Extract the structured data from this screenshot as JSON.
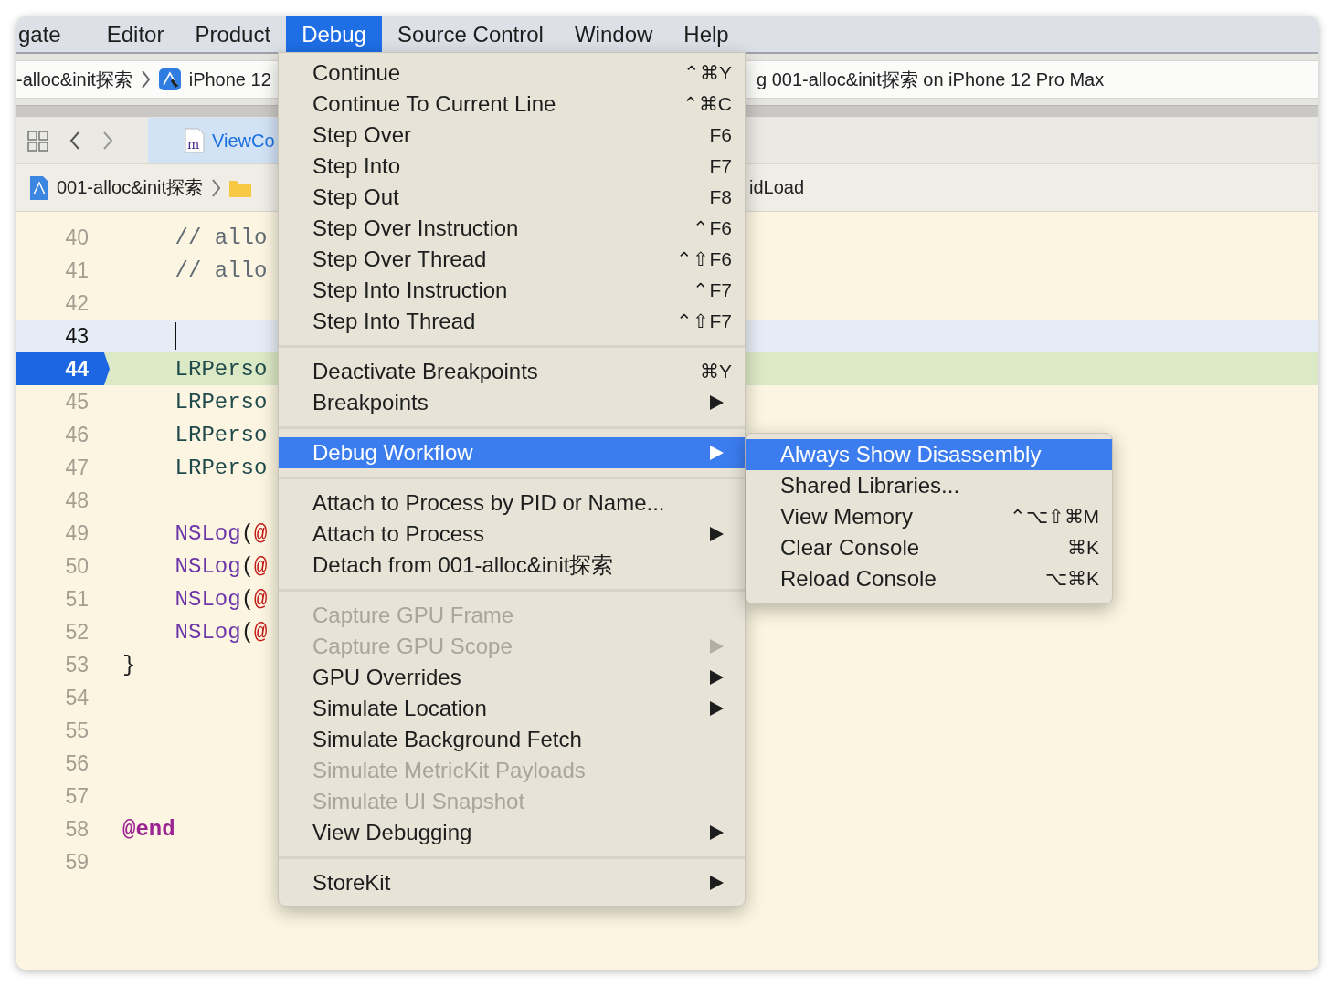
{
  "menubar": [
    {
      "label": "gate",
      "selected": false
    },
    {
      "label": "Editor",
      "selected": false
    },
    {
      "label": "Product",
      "selected": false
    },
    {
      "label": "Debug",
      "selected": true
    },
    {
      "label": "Source Control",
      "selected": false
    },
    {
      "label": "Window",
      "selected": false
    },
    {
      "label": "Help",
      "selected": false
    }
  ],
  "toolbar": {
    "scheme": "-alloc&init探索",
    "device": "iPhone 12",
    "activity": "g 001-alloc&init探索 on iPhone 12 Pro Max"
  },
  "tab": {
    "label": "ViewCo",
    "icon_text": "m",
    "selected": true
  },
  "jump_bar": {
    "project": "001-alloc&init探索",
    "method": "idLoad"
  },
  "editor": {
    "lines": [
      {
        "number": "40",
        "current": false,
        "execution_point": false,
        "tokens": [
          {
            "text": "    // allo",
            "kind": "comment"
          }
        ]
      },
      {
        "number": "41",
        "current": false,
        "execution_point": false,
        "tokens": [
          {
            "text": "    // allo",
            "kind": "comment"
          }
        ]
      },
      {
        "number": "42",
        "current": false,
        "execution_point": false
      },
      {
        "number": "43",
        "current": true,
        "execution_point": false
      },
      {
        "number": "44",
        "current": false,
        "execution_point": true,
        "tokens": [
          {
            "text": "    LRPerso",
            "kind": "type"
          }
        ]
      },
      {
        "number": "45",
        "current": false,
        "execution_point": false,
        "tokens": [
          {
            "text": "    LRPerso",
            "kind": "type"
          }
        ]
      },
      {
        "number": "46",
        "current": false,
        "execution_point": false,
        "tokens": [
          {
            "text": "    LRPerso",
            "kind": "type"
          }
        ]
      },
      {
        "number": "47",
        "current": false,
        "execution_point": false,
        "tokens": [
          {
            "text": "    LRPerso",
            "kind": "type"
          }
        ]
      },
      {
        "number": "48",
        "current": false,
        "execution_point": false
      },
      {
        "number": "49",
        "current": false,
        "execution_point": false,
        "tokens": [
          {
            "text": "    NSLog",
            "kind": "function"
          },
          {
            "text": "(",
            "kind": "plain"
          },
          {
            "text": "@",
            "kind": "string"
          }
        ]
      },
      {
        "number": "50",
        "current": false,
        "execution_point": false,
        "tokens": [
          {
            "text": "    NSLog",
            "kind": "function"
          },
          {
            "text": "(",
            "kind": "plain"
          },
          {
            "text": "@",
            "kind": "string"
          }
        ]
      },
      {
        "number": "51",
        "current": false,
        "execution_point": false,
        "tokens": [
          {
            "text": "    NSLog",
            "kind": "function"
          },
          {
            "text": "(",
            "kind": "plain"
          },
          {
            "text": "@",
            "kind": "string"
          }
        ]
      },
      {
        "number": "52",
        "current": false,
        "execution_point": false,
        "tokens": [
          {
            "text": "    NSLog",
            "kind": "function"
          },
          {
            "text": "(",
            "kind": "plain"
          },
          {
            "text": "@",
            "kind": "string"
          }
        ]
      },
      {
        "number": "53",
        "current": false,
        "execution_point": false,
        "tokens": [
          {
            "text": "}",
            "kind": "plain"
          }
        ]
      },
      {
        "number": "54",
        "current": false,
        "execution_point": false
      },
      {
        "number": "55",
        "current": false,
        "execution_point": false
      },
      {
        "number": "56",
        "current": false,
        "execution_point": false
      },
      {
        "number": "57",
        "current": false,
        "execution_point": false
      },
      {
        "number": "58",
        "current": false,
        "execution_point": false,
        "tokens": [
          {
            "text": "@end",
            "kind": "keyword"
          }
        ]
      },
      {
        "number": "59",
        "current": false,
        "execution_point": false
      }
    ]
  },
  "debug_menu": {
    "items": [
      {
        "kind": "item",
        "label": "Continue",
        "shortcut": "⌃⌘Y",
        "submenu": false,
        "disabled": false,
        "selected": false
      },
      {
        "kind": "item",
        "label": "Continue To Current Line",
        "shortcut": "⌃⌘C",
        "submenu": false,
        "disabled": false,
        "selected": false
      },
      {
        "kind": "item",
        "label": "Step Over",
        "shortcut": "F6",
        "submenu": false,
        "disabled": false,
        "selected": false
      },
      {
        "kind": "item",
        "label": "Step Into",
        "shortcut": "F7",
        "submenu": false,
        "disabled": false,
        "selected": false
      },
      {
        "kind": "item",
        "label": "Step Out",
        "shortcut": "F8",
        "submenu": false,
        "disabled": false,
        "selected": false
      },
      {
        "kind": "item",
        "label": "Step Over Instruction",
        "shortcut": "⌃F6",
        "submenu": false,
        "disabled": false,
        "selected": false
      },
      {
        "kind": "item",
        "label": "Step Over Thread",
        "shortcut": "⌃⇧F6",
        "submenu": false,
        "disabled": false,
        "selected": false
      },
      {
        "kind": "item",
        "label": "Step Into Instruction",
        "shortcut": "⌃F7",
        "submenu": false,
        "disabled": false,
        "selected": false
      },
      {
        "kind": "item",
        "label": "Step Into Thread",
        "shortcut": "⌃⇧F7",
        "submenu": false,
        "disabled": false,
        "selected": false
      },
      {
        "kind": "separator"
      },
      {
        "kind": "item",
        "label": "Deactivate Breakpoints",
        "shortcut": "⌘Y",
        "submenu": false,
        "disabled": false,
        "selected": false
      },
      {
        "kind": "item",
        "label": "Breakpoints",
        "submenu": true,
        "disabled": false,
        "selected": false
      },
      {
        "kind": "separator"
      },
      {
        "kind": "item",
        "label": "Debug Workflow",
        "submenu": true,
        "disabled": false,
        "selected": true
      },
      {
        "kind": "separator"
      },
      {
        "kind": "item",
        "label": "Attach to Process by PID or Name...",
        "submenu": false,
        "disabled": false,
        "selected": false
      },
      {
        "kind": "item",
        "label": "Attach to Process",
        "submenu": true,
        "disabled": false,
        "selected": false
      },
      {
        "kind": "item",
        "label": "Detach from 001-alloc&init探索",
        "submenu": false,
        "disabled": false,
        "selected": false
      },
      {
        "kind": "separator"
      },
      {
        "kind": "item",
        "label": "Capture GPU Frame",
        "submenu": false,
        "disabled": true,
        "selected": false
      },
      {
        "kind": "item",
        "label": "Capture GPU Scope",
        "submenu": true,
        "disabled": true,
        "selected": false
      },
      {
        "kind": "item",
        "label": "GPU Overrides",
        "submenu": true,
        "disabled": false,
        "selected": false
      },
      {
        "kind": "item",
        "label": "Simulate Location",
        "submenu": true,
        "disabled": false,
        "selected": false
      },
      {
        "kind": "item",
        "label": "Simulate Background Fetch",
        "submenu": false,
        "disabled": false,
        "selected": false
      },
      {
        "kind": "item",
        "label": "Simulate MetricKit Payloads",
        "submenu": false,
        "disabled": true,
        "selected": false
      },
      {
        "kind": "item",
        "label": "Simulate UI Snapshot",
        "submenu": false,
        "disabled": true,
        "selected": false
      },
      {
        "kind": "item",
        "label": "View Debugging",
        "submenu": true,
        "disabled": false,
        "selected": false
      },
      {
        "kind": "separator"
      },
      {
        "kind": "item",
        "label": "StoreKit",
        "submenu": true,
        "disabled": false,
        "selected": false
      }
    ]
  },
  "workflow_submenu": {
    "items": [
      {
        "kind": "item",
        "label": "Always Show Disassembly",
        "submenu": false,
        "disabled": false,
        "selected": true
      },
      {
        "kind": "item",
        "label": "Shared Libraries...",
        "submenu": false,
        "disabled": false,
        "selected": false
      },
      {
        "kind": "item",
        "label": "View Memory",
        "shortcut": "⌃⌥⇧⌘M",
        "submenu": false,
        "disabled": false,
        "selected": false
      },
      {
        "kind": "item",
        "label": "Clear Console",
        "shortcut": "⌘K",
        "submenu": false,
        "disabled": false,
        "selected": false
      },
      {
        "kind": "item",
        "label": "Reload Console",
        "shortcut": "⌥⌘K",
        "submenu": false,
        "disabled": false,
        "selected": false
      }
    ]
  }
}
